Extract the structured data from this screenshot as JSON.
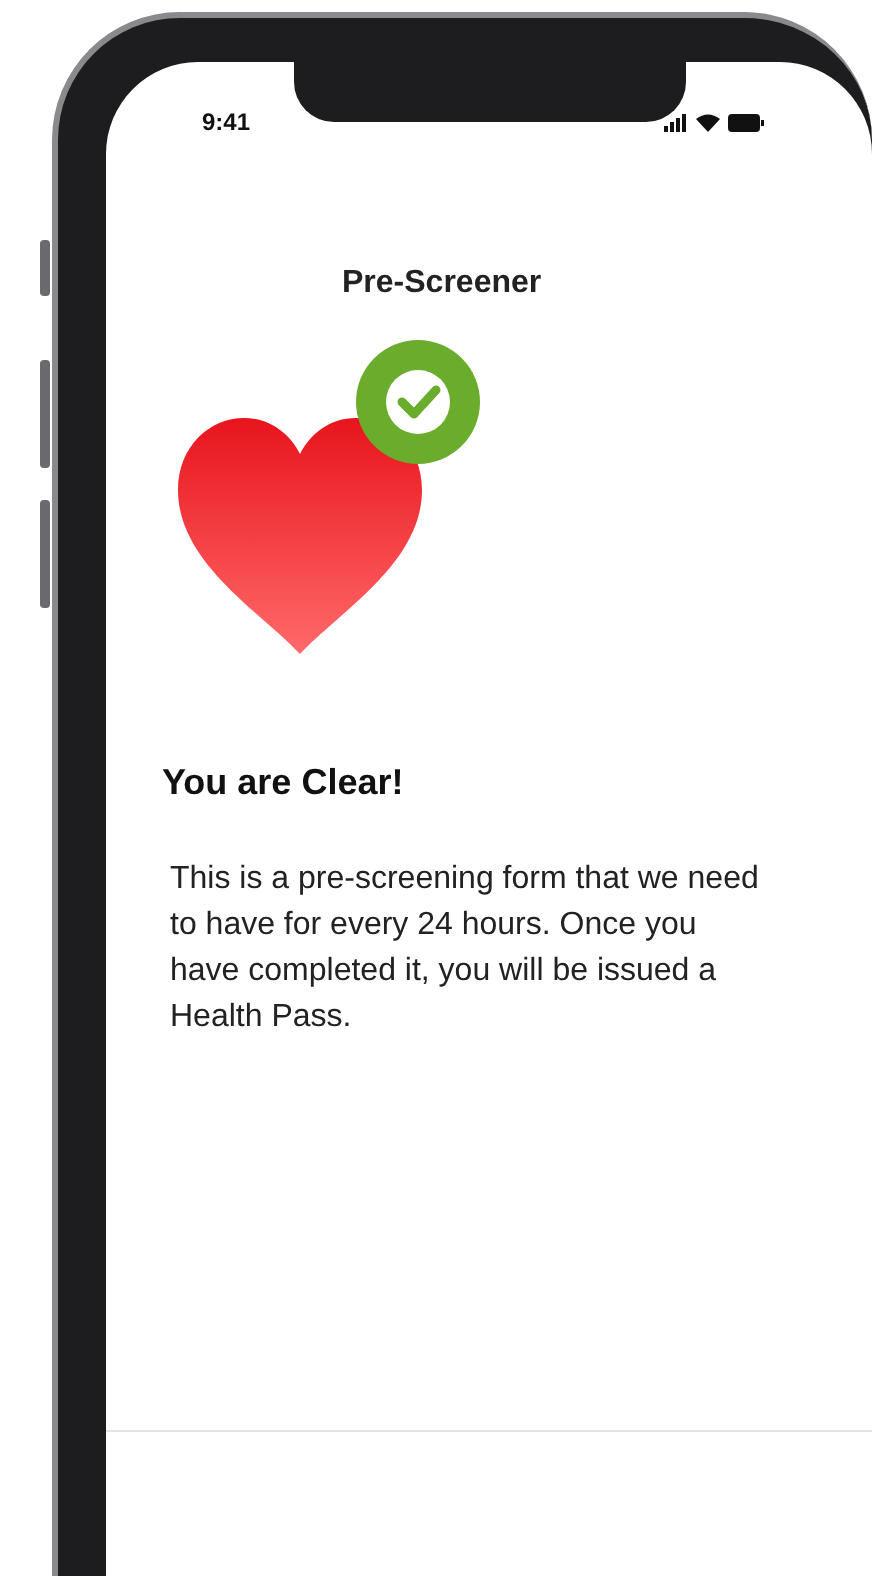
{
  "status_bar": {
    "time": "9:41"
  },
  "title": "Pre-Screener",
  "result": {
    "heading": "You are Clear!",
    "text": "This is a pre-screening form that we need to have for every 24 hours. Once you have completed it, you will be issued a Health Pass."
  }
}
